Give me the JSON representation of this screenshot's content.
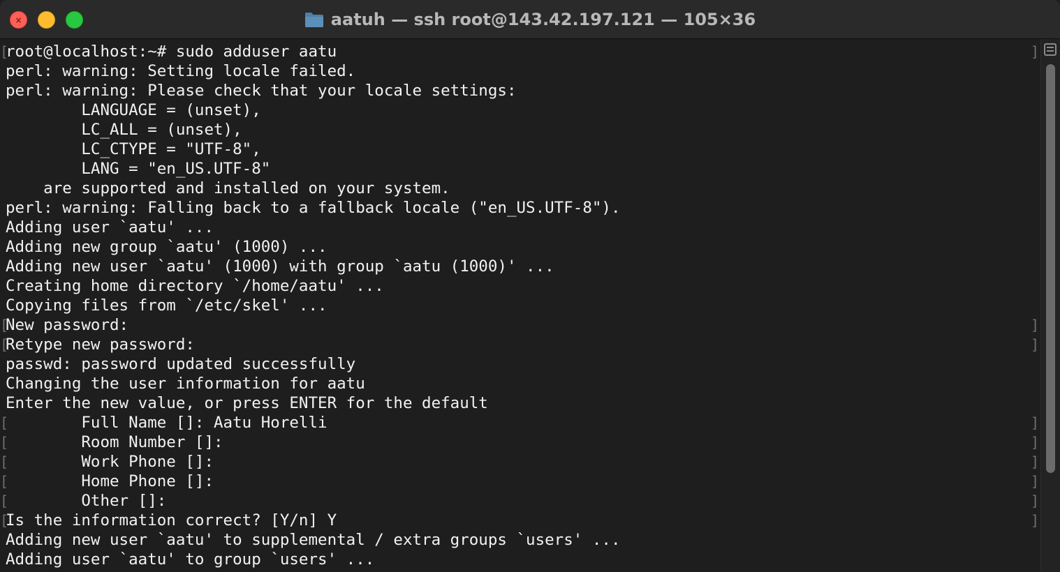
{
  "window": {
    "title": "aatuh — ssh root@143.42.197.121 — 105×36",
    "close_glyph": "×",
    "folder_icon": "folder-icon",
    "accent_colors": {
      "close": "#fe5f57",
      "minimize": "#febc2e",
      "maximize": "#28c840",
      "background": "#1e1e1e",
      "text": "#f2f2f2"
    }
  },
  "terminal": {
    "lines": [
      {
        "text": "root@localhost:~# sudo adduser aatu",
        "mark_left": "[",
        "mark_right": "]"
      },
      {
        "text": "perl: warning: Setting locale failed.",
        "mark_left": "",
        "mark_right": ""
      },
      {
        "text": "perl: warning: Please check that your locale settings:",
        "mark_left": "",
        "mark_right": ""
      },
      {
        "text": "        LANGUAGE = (unset),",
        "mark_left": "",
        "mark_right": ""
      },
      {
        "text": "        LC_ALL = (unset),",
        "mark_left": "",
        "mark_right": ""
      },
      {
        "text": "        LC_CTYPE = \"UTF-8\",",
        "mark_left": "",
        "mark_right": ""
      },
      {
        "text": "        LANG = \"en_US.UTF-8\"",
        "mark_left": "",
        "mark_right": ""
      },
      {
        "text": "    are supported and installed on your system.",
        "mark_left": "",
        "mark_right": ""
      },
      {
        "text": "perl: warning: Falling back to a fallback locale (\"en_US.UTF-8\").",
        "mark_left": "",
        "mark_right": ""
      },
      {
        "text": "Adding user `aatu' ...",
        "mark_left": "",
        "mark_right": ""
      },
      {
        "text": "Adding new group `aatu' (1000) ...",
        "mark_left": "",
        "mark_right": ""
      },
      {
        "text": "Adding new user `aatu' (1000) with group `aatu (1000)' ...",
        "mark_left": "",
        "mark_right": ""
      },
      {
        "text": "Creating home directory `/home/aatu' ...",
        "mark_left": "",
        "mark_right": ""
      },
      {
        "text": "Copying files from `/etc/skel' ...",
        "mark_left": "",
        "mark_right": ""
      },
      {
        "text": "New password:",
        "mark_left": "[",
        "mark_right": "]"
      },
      {
        "text": "Retype new password:",
        "mark_left": "[",
        "mark_right": "]"
      },
      {
        "text": "passwd: password updated successfully",
        "mark_left": "",
        "mark_right": ""
      },
      {
        "text": "Changing the user information for aatu",
        "mark_left": "",
        "mark_right": ""
      },
      {
        "text": "Enter the new value, or press ENTER for the default",
        "mark_left": "",
        "mark_right": ""
      },
      {
        "text": "        Full Name []: Aatu Horelli",
        "mark_left": "[",
        "mark_right": "]"
      },
      {
        "text": "        Room Number []:",
        "mark_left": "[",
        "mark_right": "]"
      },
      {
        "text": "        Work Phone []:",
        "mark_left": "[",
        "mark_right": "]"
      },
      {
        "text": "        Home Phone []:",
        "mark_left": "[",
        "mark_right": "]"
      },
      {
        "text": "        Other []:",
        "mark_left": "[",
        "mark_right": "]"
      },
      {
        "text": "Is the information correct? [Y/n] Y",
        "mark_left": "[",
        "mark_right": "]"
      },
      {
        "text": "Adding new user `aatu' to supplemental / extra groups `users' ...",
        "mark_left": "",
        "mark_right": ""
      },
      {
        "text": "Adding user `aatu' to group `users' ...",
        "mark_left": "",
        "mark_right": ""
      }
    ]
  },
  "scrollbar": {
    "menu_icon": "scroll-menu-icon"
  }
}
